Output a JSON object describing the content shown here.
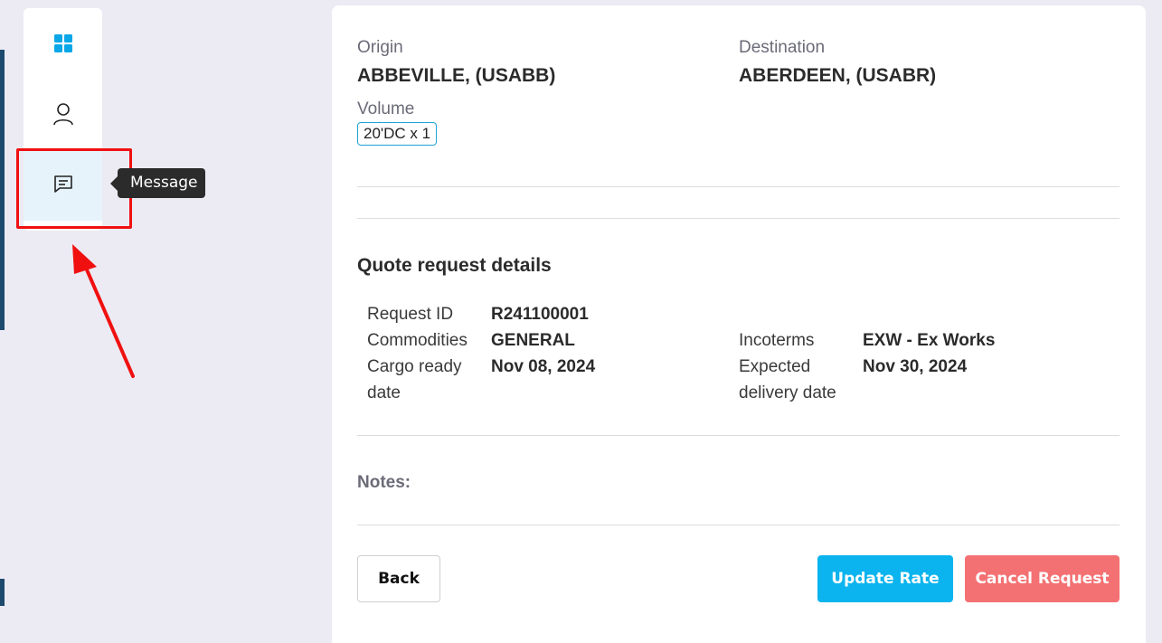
{
  "sidebar": {
    "items": [
      {
        "icon": "dashboard-grid-icon"
      },
      {
        "icon": "user-icon"
      },
      {
        "icon": "message-icon",
        "active": true
      }
    ],
    "tooltip": "Message"
  },
  "shipment": {
    "origin_label": "Origin",
    "origin_value": "ABBEVILLE, (USABB)",
    "destination_label": "Destination",
    "destination_value": "ABERDEEN, (USABR)",
    "volume_label": "Volume",
    "volume_tag": "20'DC x 1"
  },
  "details": {
    "title": "Quote request details",
    "request_id_label": "Request ID",
    "request_id_value": "R241100001",
    "commodities_label": "Commodities",
    "commodities_value": "GENERAL",
    "incoterms_label": "Incoterms",
    "incoterms_value": "EXW - Ex Works",
    "cargo_ready_label_1": "Cargo ready",
    "cargo_ready_label_2": "date",
    "cargo_ready_value": "Nov 08, 2024",
    "expected_delivery_label_1": "Expected",
    "expected_delivery_label_2": "delivery date",
    "expected_delivery_value": "Nov 30, 2024"
  },
  "notes": {
    "label": "Notes:"
  },
  "actions": {
    "back": "Back",
    "update_rate": "Update Rate",
    "cancel_request": "Cancel Request"
  },
  "colors": {
    "accent": "#0bb4ee",
    "danger": "#f47173",
    "highlight": "#f01010",
    "background": "#ecebf4"
  }
}
